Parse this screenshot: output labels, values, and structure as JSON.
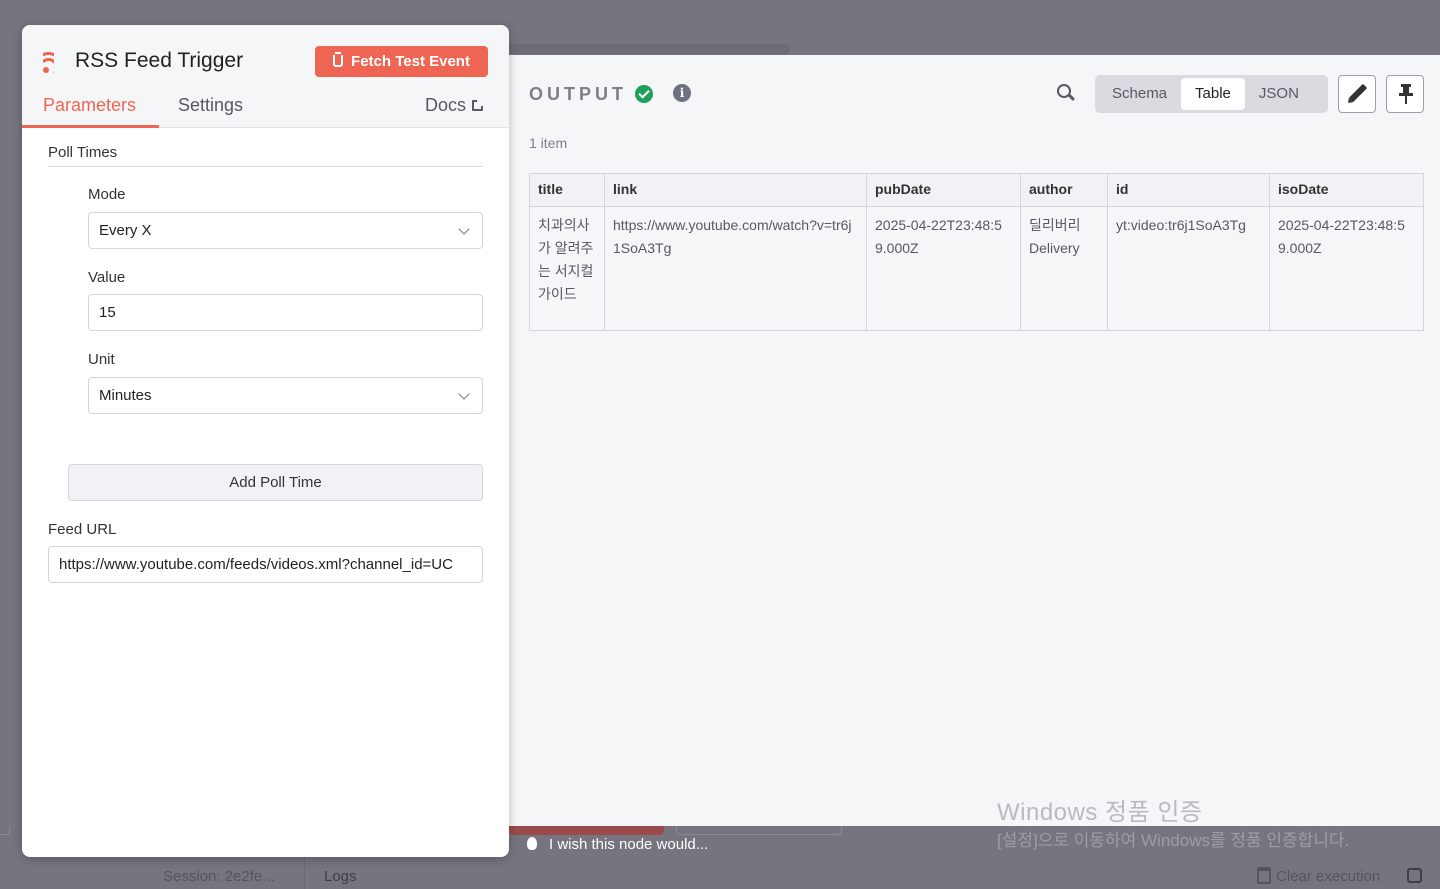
{
  "background": {
    "session": "Session: 2e2fe...",
    "logs": "Logs",
    "clear_execution": "Clear execution",
    "hint": "I wish this node would..."
  },
  "node": {
    "title": "RSS Feed Trigger",
    "icon": "rss-icon",
    "fetch_button": "Fetch Test Event",
    "tabs": {
      "parameters": "Parameters",
      "settings": "Settings"
    },
    "docs": "Docs"
  },
  "parameters": {
    "section": "Poll Times",
    "mode_label": "Mode",
    "mode_value": "Every X",
    "value_label": "Value",
    "value_value": "15",
    "unit_label": "Unit",
    "unit_value": "Minutes",
    "add_poll_time": "Add Poll Time",
    "feed_url_label": "Feed URL",
    "feed_url_value": "https://www.youtube.com/feeds/videos.xml?channel_id=UC"
  },
  "output": {
    "title": "OUTPUT",
    "item_count": "1 item",
    "views": [
      "Schema",
      "Table",
      "JSON"
    ],
    "active_view": "Table",
    "columns": [
      "title",
      "link",
      "pubDate",
      "author",
      "id",
      "isoDate"
    ],
    "rows": [
      {
        "title": "치과의사가 알려주는 서지컬 가이드",
        "link": "https://www.youtube.com/watch?v=tr6j1SoA3Tg",
        "pubDate": "2025-04-22T23:48:59.000Z",
        "author": "딜리버리 Delivery",
        "id": "yt:video:tr6j1SoA3Tg",
        "isoDate": "2025-04-22T23:48:59.000Z"
      }
    ]
  },
  "watermark": {
    "line1": "Windows 정품 인증",
    "line2": "[설정]으로 이동하여 Windows를 정품 인증합니다."
  },
  "colors": {
    "accent": "#ef6553",
    "success": "#1fa05a",
    "overlay": "#76757f"
  }
}
